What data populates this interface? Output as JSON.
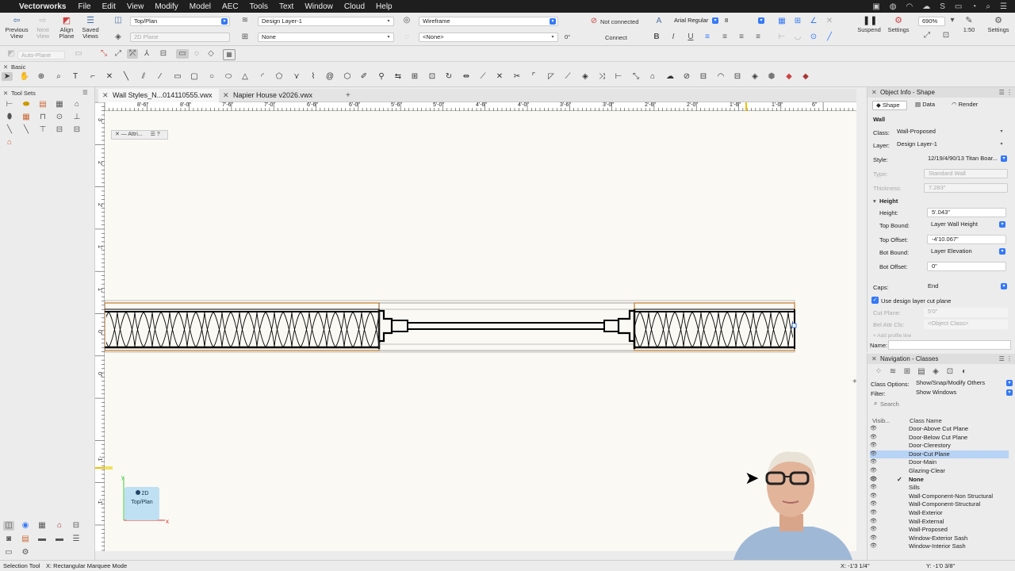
{
  "menubar": {
    "app": "Vectorworks",
    "items": [
      "File",
      "Edit",
      "View",
      "Modify",
      "Model",
      "AEC",
      "Tools",
      "Text",
      "Window",
      "Cloud",
      "Help"
    ]
  },
  "toolbar": {
    "previous_view": "Previous View",
    "next_view": "Next View",
    "align_plane": "Align Plane",
    "saved_views": "Saved Views",
    "view_select": "Top/Plan",
    "plane_select": "2D Plane",
    "layer_select": "Design Layer-1",
    "class_select": "None",
    "render_select": "Wireframe",
    "none_select": "<None>",
    "angle_value": "0°",
    "not_connected": "Not connected",
    "connect": "Connect",
    "font_select": "Arial Regular",
    "size_select": "8",
    "suspend": "Suspend",
    "settings": "Settings",
    "zoom_value": "690%",
    "scale_value": "1:50",
    "settings2": "Settings"
  },
  "modebar": {
    "auto_plane": "Auto-Plane"
  },
  "basic_palette": {
    "title": "Basic"
  },
  "toolsets": {
    "title": "Tool Sets"
  },
  "tabs": [
    {
      "label": "Wall Styles_N...014110555.vwx"
    },
    {
      "label": "Napier House v2026.vwx"
    }
  ],
  "attributes": {
    "label": "Attri..."
  },
  "ruler_top": [
    "8'-6\"",
    "8'-0\"",
    "7'-6\"",
    "7'-0\"",
    "6'-6\"",
    "6'-0\"",
    "5'-6\"",
    "5'-0\"",
    "4'-6\"",
    "4'-0\"",
    "3'-6\"",
    "3'-0\"",
    "2'-6\"",
    "2'-0\"",
    "1'-6\"",
    "1'-0\"",
    "6\""
  ],
  "ruler_left": [
    "3'",
    "2'",
    "2'",
    "1'",
    "1'",
    "0\"",
    "0\"",
    "-1'",
    "-1'"
  ],
  "viewcube": {
    "mode": "2D",
    "view": "Top/Plan"
  },
  "axes": {
    "x": "x",
    "y": "y"
  },
  "object_info": {
    "title": "Object Info - Shape",
    "tabs": [
      "Shape",
      "Data",
      "Render"
    ],
    "object_type": "Wall",
    "class_label": "Class:",
    "class_value": "Wall-Proposed",
    "layer_label": "Layer:",
    "layer_value": "Design Layer-1",
    "style_label": "Style:",
    "style_value": "12/19/4/90/13 Titan Boar...",
    "type_label": "Type:",
    "type_value": "Standard Wall",
    "thickness_label": "Thickness:",
    "thickness_value": "7.283\"",
    "height_section": "Height",
    "height_label": "Height:",
    "height_value": "5'.043\"",
    "top_bound_label": "Top Bound:",
    "top_bound_value": "Layer Wall Height",
    "top_offset_label": "Top Offset:",
    "top_offset_value": "-4'10.067\"",
    "bot_bound_label": "Bot Bound:",
    "bot_bound_value": "Layer Elevation",
    "bot_offset_label": "Bot Offset:",
    "bot_offset_value": "0\"",
    "caps_label": "Caps:",
    "caps_value": "End",
    "use_cut_plane": "Use design layer cut plane",
    "cut_plane_label": "Cut Plane:",
    "cut_plane_value": "5'0\"",
    "bel_attr_label": "Bel Attr Cls:",
    "bel_attr_value": "<Object Class>",
    "add_profile": "+ Add profile line",
    "name_label": "Name:"
  },
  "navigation": {
    "title": "Navigation - Classes",
    "class_options_label": "Class Options:",
    "class_options_value": "Show/Snap/Modify Others",
    "filter_label": "Filter:",
    "filter_value": "Show Windows",
    "search_placeholder": "Search",
    "col_visibility": "Visib...",
    "col_name": "Class Name",
    "classes": [
      "Door-Above Cut Plane",
      "Door-Below Cut Plane",
      "Door-Clerestory",
      "Door-Cut Plane",
      "Door-Main",
      "Glazing-Clear",
      "None",
      "Sills",
      "Wall-Component-Non Structural",
      "Wall-Component-Structural",
      "Wall-Exterior",
      "Wall-External",
      "Wall-Proposed",
      "Window-Exterior Sash",
      "Window-Interior Sash"
    ]
  },
  "status": {
    "tool": "Selection Tool",
    "mode": "X:  Rectangular Marquee Mode",
    "x_coord": "X: -1'3 1/4\"",
    "y_coord": "Y: -1'0 3/8\""
  },
  "colors": {
    "accent": "#3478f6",
    "selection": "#b7d3f5",
    "canvas": "#faf9f3",
    "wall_outline": "#c07828"
  }
}
